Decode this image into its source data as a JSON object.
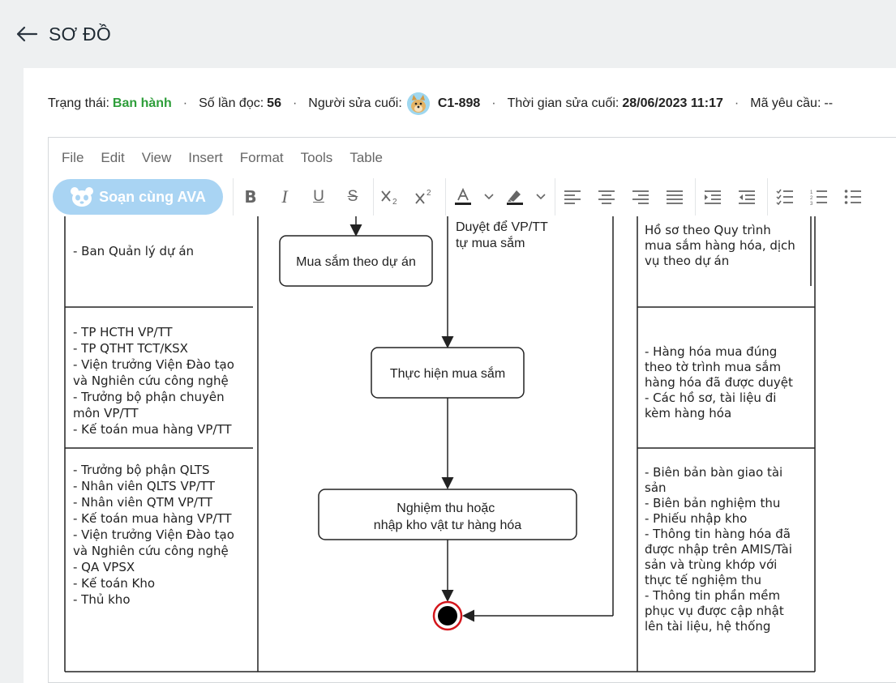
{
  "header": {
    "title": "SƠ ĐỒ"
  },
  "meta": {
    "status_label": "Trạng thái:",
    "status_value": "Ban hành",
    "reads_label": "Số lần đọc:",
    "reads_value": "56",
    "editor_label": "Người sửa cuối:",
    "editor_value": "C1-898",
    "time_label": "Thời gian sửa cuối:",
    "time_value": "28/06/2023 11:17",
    "request_label": "Mã yêu cầu:",
    "request_value": "--"
  },
  "menu": [
    "File",
    "Edit",
    "View",
    "Insert",
    "Format",
    "Tools",
    "Table"
  ],
  "toolbar": {
    "ava_label": "Soạn cùng AVA",
    "bold": "B",
    "italic": "I",
    "underline": "U",
    "strike": "S"
  },
  "diagram": {
    "left_col": [
      [
        "- Ban Quản lý dự án"
      ],
      [
        "- TP HCTH VP/TT",
        "- TP QTHT TCT/KSX",
        "- Viện trưởng Viện Đào tạo",
        "và Nghiên cứu công nghệ",
        "- Trưởng bộ phận chuyên",
        "môn VP/TT",
        "- Kế toán mua hàng VP/TT"
      ],
      [
        "- Trưởng bộ phận QLTS",
        "- Nhân viên QLTS VP/TT",
        "- Nhân viên QTM VP/TT",
        "- Kế toán mua hàng VP/TT",
        "- Viện trưởng Viện Đào tạo",
        "và Nghiên cứu công nghệ",
        "- QA VPSX",
        "- Kế toán Kho",
        "- Thủ kho"
      ]
    ],
    "flow_note": [
      "Duyệt để VP/TT",
      "tự mua sắm"
    ],
    "boxes": {
      "purchase_project": "Mua sắm theo dự án",
      "execute_purchase": "Thực hiện mua sắm",
      "acceptance": [
        "Nghiệm thu hoặc",
        "nhập kho vật tư hàng hóa"
      ]
    },
    "right_col": [
      [
        "Hồ sơ theo Quy trình",
        "mua sắm hàng hóa, dịch",
        "vụ theo dự án"
      ],
      [
        "- Hàng hóa mua đúng",
        "theo tờ trình mua sắm",
        "hàng hóa đã được duyệt",
        "- Các hồ sơ, tài liệu đi",
        "kèm hàng hóa"
      ],
      [
        "- Biên bản bàn giao tài",
        "sản",
        "- Biên bản nghiệm thu",
        "- Phiếu nhập kho",
        "- Thông tin hàng hóa đã",
        "được nhập trên AMIS/Tài",
        "sản và trùng khớp với",
        "thực tế nghiệm thu",
        "- Thông tin phần mềm",
        "phục vụ được cập nhật",
        "lên tài liệu, hệ thống"
      ]
    ]
  }
}
